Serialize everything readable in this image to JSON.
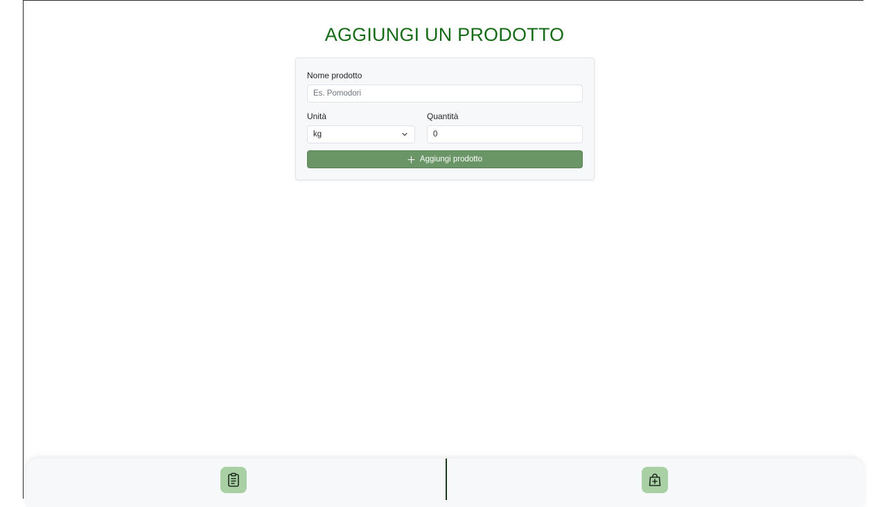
{
  "page": {
    "title": "AGGIUNGI UN PRODOTTO"
  },
  "form": {
    "name_label": "Nome prodotto",
    "name_placeholder": "Es. Pomodori",
    "name_value": "",
    "unit_label": "Unità",
    "unit_value": "kg",
    "quantity_label": "Quantità",
    "quantity_value": "0",
    "add_button_label": "Aggiungi prodotto"
  },
  "bottom_nav": {
    "items": [
      {
        "icon": "clipboard-list-icon",
        "active": false
      },
      {
        "icon": "bag-plus-icon",
        "active": true
      }
    ]
  },
  "colors": {
    "title": "#156b16",
    "button": "#6a9566",
    "nav_button": "#a9cfa4"
  }
}
